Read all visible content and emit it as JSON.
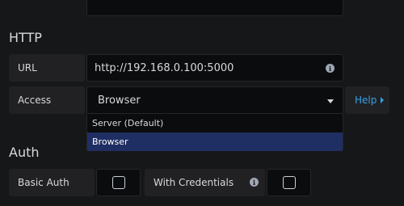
{
  "http": {
    "title": "HTTP",
    "url": {
      "label": "URL",
      "value": "http://192.168.0.100:5000",
      "info_icon": "info-icon"
    },
    "access": {
      "label": "Access",
      "selected": "Browser",
      "help_label": "Help",
      "options": [
        "Server (Default)",
        "Browser"
      ]
    }
  },
  "auth": {
    "title": "Auth",
    "basic_auth_label": "Basic Auth",
    "with_credentials_label": "With Credentials"
  },
  "colors": {
    "accent_link": "#33a2e5",
    "selected_option_bg": "#1f2f63"
  }
}
